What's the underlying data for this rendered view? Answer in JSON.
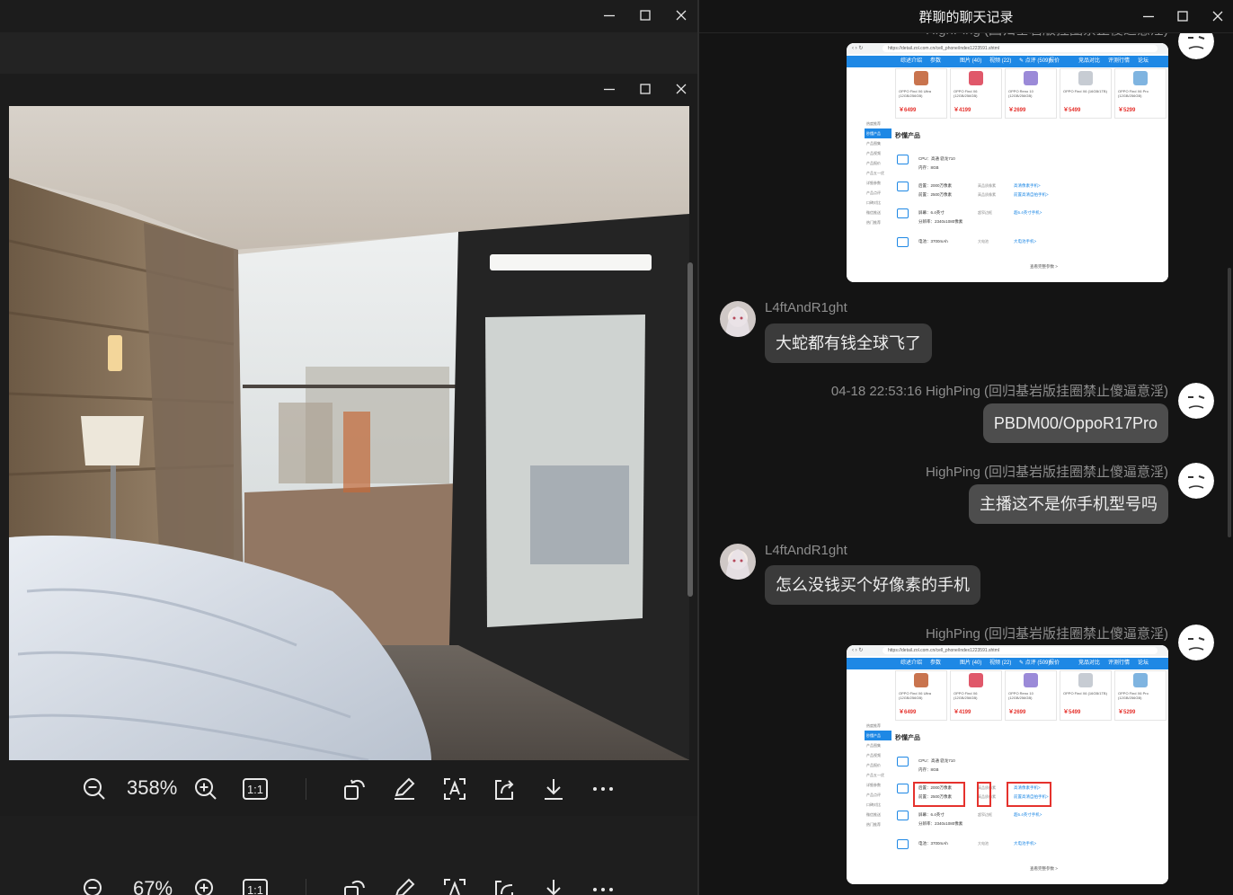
{
  "viewer": {
    "zoom_primary": "358%",
    "zoom_secondary": "67%",
    "actual_size_label": "1:1"
  },
  "chat": {
    "title": "群聊的聊天记录",
    "partial_sender": "HighPing (回归基岩版挂圈禁止傻逼意淫)",
    "messages": [
      {
        "sender": "L4ftAndR1ght",
        "text": "大蛇都有钱全球飞了"
      },
      {
        "sender": "04-18 22:53:16 HighPing (回归基岩版挂圈禁止傻逼意淫)",
        "text": "PBDM00/OppoR17Pro"
      },
      {
        "sender": "HighPing (回归基岩版挂圈禁止傻逼意淫)",
        "text": "主播这不是你手机型号吗"
      },
      {
        "sender": "L4ftAndR1ght",
        "text": "怎么没钱买个好像素的手机"
      },
      {
        "sender": "HighPing (回归基岩版挂圈禁止傻逼意淫)",
        "text": ""
      }
    ]
  },
  "screenshot": {
    "url": "https://detail.zol.com.cn/cell_phone/index1223591.shtml",
    "tabs": [
      "综述介绍",
      "参数",
      "图片 (40)",
      "视频 (22)",
      "✎ 点评 (509)",
      "报价",
      "竞品对比",
      "评测行情",
      "论坛"
    ],
    "products": [
      {
        "name": "OPPO Find X6 Ultra (12GB/256GB)",
        "price": "￥6499"
      },
      {
        "name": "OPPO Find X6 (12GB/256GB)",
        "price": "￥4199"
      },
      {
        "name": "OPPO Reno 10 (12GB/256GB)",
        "price": "￥2699"
      },
      {
        "name": "OPPO Find X6 (16GB/1TB)",
        "price": "￥5499"
      },
      {
        "name": "OPPO Find X6 Pro (12GB/256GB)",
        "price": "￥5299"
      }
    ],
    "side_menu": [
      "热度推荐",
      "秒懂产品",
      "产品图集",
      "产品视频",
      "产品报价",
      "产品五一优",
      "详细参数",
      "产品点评",
      "口碑对比",
      "微信推送",
      "热门推荐"
    ],
    "section_title": "秒懂产品",
    "spec_cpu": "CPU：高通 骁龙710",
    "spec_ram": "内存：8GB",
    "spec_rear_cam": "后置：2000万像素",
    "spec_front_cam": "前置：2500万像素",
    "spec_screen": "屏幕：6.4英寸",
    "spec_resolution": "分辨率：2340x1080像素",
    "spec_battery": "电池：3700mAh",
    "link_rear": "高清像素手机>",
    "link_front": "前置高清自拍手机>",
    "link_screen": "超6.4英寸手机>",
    "link_battery": "大电池手机>",
    "tag_rear": "高品质像素",
    "tag_front": "高品质像素",
    "tag_screen": "超窄边框",
    "tag_battery": "大电池",
    "more": "查看完整参数 >"
  }
}
